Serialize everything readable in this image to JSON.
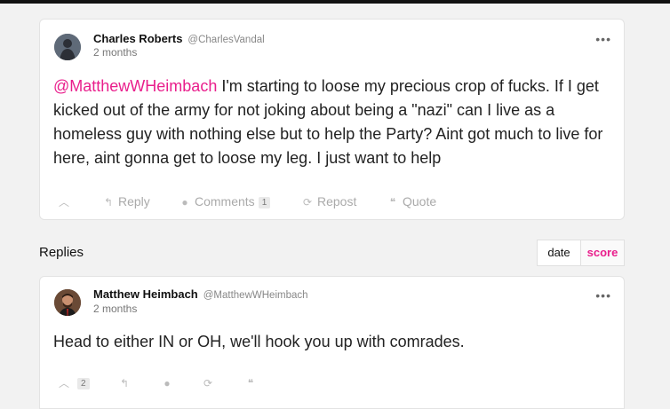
{
  "post": {
    "author_name": "Charles Roberts",
    "author_handle": "@CharlesVandal",
    "time": "2 months",
    "mention": "@MatthewWHeimbach",
    "text": " I'm starting to loose my precious crop of fucks. If I get kicked out of the army for not joking about being a \"nazi\" can I live as a homeless guy with nothing else but to help the Party? Aint got much to live for here, aint gonna get to loose my leg. I just want to help",
    "more": "•••",
    "actions": {
      "upvote_icon": "chevron-up-icon",
      "reply_label": "Reply",
      "comments_label": "Comments",
      "comments_count": "1",
      "repost_label": "Repost",
      "quote_label": "Quote"
    }
  },
  "replies": {
    "label": "Replies",
    "sort": {
      "date": "date",
      "score": "score",
      "active": "score"
    }
  },
  "reply": {
    "author_name": "Matthew Heimbach",
    "author_handle": "@MatthewWHeimbach",
    "time": "2 months",
    "text": "Head to either IN or OH, we'll hook you up with comrades.",
    "more": "•••",
    "actions": {
      "upvote_count": "2"
    }
  },
  "colors": {
    "accent": "#e91e8c",
    "background": "#f2f2f2",
    "card": "#ffffff"
  }
}
